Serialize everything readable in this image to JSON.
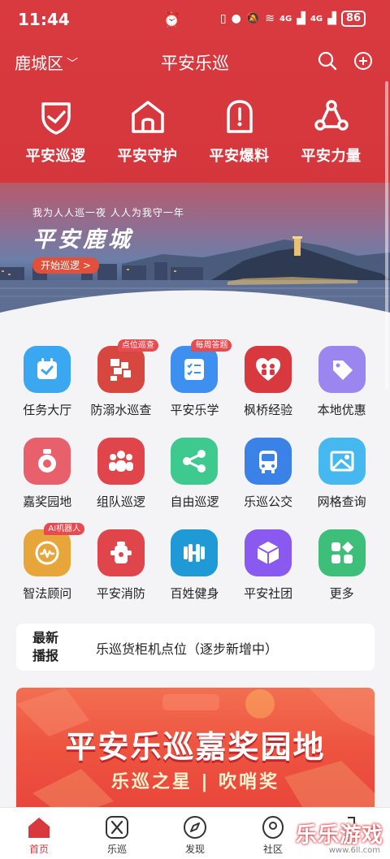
{
  "status": {
    "time": "11:44",
    "battery": "86",
    "net1": "4G",
    "net2": "4G"
  },
  "header": {
    "district": "鹿城区",
    "title": "平安乐巡"
  },
  "quick": [
    {
      "label": "平安巡逻",
      "icon": "shield-icon"
    },
    {
      "label": "平安守护",
      "icon": "house-icon"
    },
    {
      "label": "平安爆料",
      "icon": "alert-icon"
    },
    {
      "label": "平安力量",
      "icon": "network-icon"
    }
  ],
  "banner": {
    "slogan": "我为人人巡一夜  人人为我守一年",
    "title": "平安鹿城",
    "button": "开始巡逻 >"
  },
  "grid": [
    [
      {
        "label": "任务大厅",
        "icon": "calendar-check-icon",
        "color": "#3aa7f0",
        "badge": ""
      },
      {
        "label": "防溺水巡查",
        "icon": "mosaic-icon",
        "color": "#d8473f",
        "badge": "点位巡查"
      },
      {
        "label": "平安乐学",
        "icon": "checklist-icon",
        "color": "#3d8ff0",
        "badge": "每周答题"
      },
      {
        "label": "枫桥经验",
        "icon": "heart-people-icon",
        "color": "#d8393e",
        "badge": ""
      },
      {
        "label": "本地优惠",
        "icon": "tag-icon",
        "color": "#9b86f0",
        "badge": ""
      }
    ],
    [
      {
        "label": "嘉奖园地",
        "icon": "medal-icon",
        "color": "#e8606b",
        "badge": ""
      },
      {
        "label": "组队巡逻",
        "icon": "group-icon",
        "color": "#e0454b",
        "badge": ""
      },
      {
        "label": "自由巡逻",
        "icon": "share-nodes-icon",
        "color": "#3ec98e",
        "badge": ""
      },
      {
        "label": "乐巡公交",
        "icon": "bus-icon",
        "color": "#3b82e8",
        "badge": ""
      },
      {
        "label": "网格查询",
        "icon": "map-icon",
        "color": "#45b8f0",
        "badge": ""
      }
    ],
    [
      {
        "label": "智法顾问",
        "icon": "robot-icon",
        "color": "#e8a53a",
        "badge": "AI机器人"
      },
      {
        "label": "平安消防",
        "icon": "hydrant-icon",
        "color": "#e0454b",
        "badge": ""
      },
      {
        "label": "百姓健身",
        "icon": "dumbbell-icon",
        "color": "#1f9ad6",
        "badge": ""
      },
      {
        "label": "平安社团",
        "icon": "cube-icon",
        "color": "#8a5af0",
        "badge": ""
      },
      {
        "label": "更多",
        "icon": "apps-icon",
        "color": "#3dbf7a",
        "badge": ""
      }
    ]
  ],
  "news": {
    "tag_line1": "最新",
    "tag_line2": "播报",
    "text": "乐巡货柜机点位（逐步新增中）"
  },
  "promo": {
    "title": "平安乐巡嘉奖园地",
    "subtitle": "乐巡之星 | 吹哨奖"
  },
  "tabs": [
    {
      "label": "首页",
      "icon": "home-icon",
      "active": true
    },
    {
      "label": "乐巡",
      "icon": "tools-icon",
      "active": false
    },
    {
      "label": "发现",
      "icon": "compass-icon",
      "active": false
    },
    {
      "label": "社区",
      "icon": "community-icon",
      "active": false
    },
    {
      "label": "",
      "icon": "profile-icon",
      "active": false
    }
  ],
  "watermark": {
    "text": "乐乐游戏",
    "url": "www.6ll.com"
  },
  "accent": "#d8393e"
}
